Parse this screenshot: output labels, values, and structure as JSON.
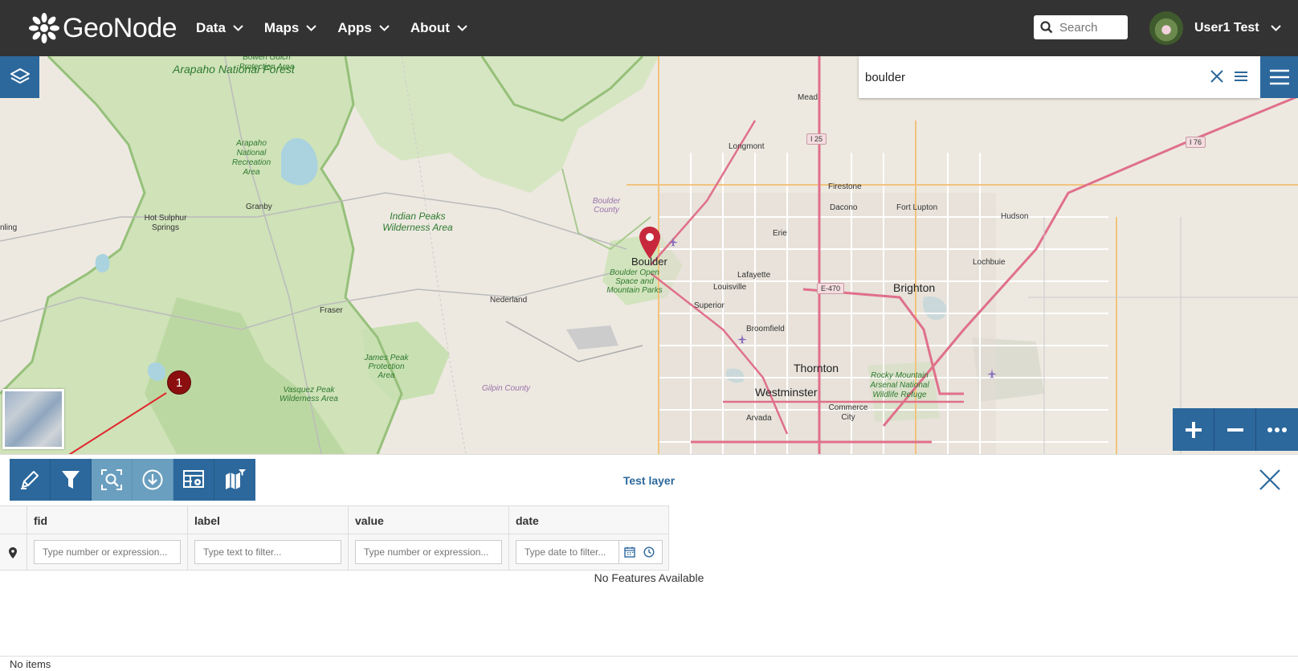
{
  "navbar": {
    "brand": "GeoNode",
    "menus": [
      {
        "label": "Data"
      },
      {
        "label": "Maps"
      },
      {
        "label": "Apps"
      },
      {
        "label": "About"
      }
    ],
    "search_placeholder": "Search",
    "user_name": "User1 Test"
  },
  "map_search": {
    "value": "boulder"
  },
  "map_labels": {
    "arapaho": "Arapaho National Forest",
    "bowen": "Bowen Gulch Protection Area",
    "arapaho_rec": "Arapaho National Recreation Area",
    "hot_sulphur": "Hot Sulphur Springs",
    "granby": "Granby",
    "indian_peaks": "Indian Peaks Wilderness Area",
    "boulder_county": "Boulder County",
    "boulder": "Boulder",
    "boulder_open": "Boulder Open Space and Mountain Parks",
    "nederland": "Nederland",
    "fraser": "Fraser",
    "james_peak": "James Peak Protection Area",
    "vasquez": "Vasquez Peak Wilderness Area",
    "gilpin": "Gilpin County",
    "longmont": "Longmont",
    "mead": "Mead",
    "firestone": "Firestone",
    "dacono": "Dacono",
    "fort_lupton": "Fort Lupton",
    "hudson": "Hudson",
    "erie": "Erie",
    "lafayette": "Lafayette",
    "louisville": "Louisville",
    "superior": "Superior",
    "broomfield": "Broomfield",
    "brighton": "Brighton",
    "lochbuie": "Lochbuie",
    "thornton": "Thornton",
    "westminster": "Westminster",
    "arvada": "Arvada",
    "commerce": "Commerce City",
    "rocky": "Rocky Mountain Arsenal National Wildlife Refuge",
    "nling": "nling",
    "i25": "I 25",
    "i76": "I 76",
    "e470": "E-470"
  },
  "annotation": {
    "marker_number": "1"
  },
  "feature_grid": {
    "title": "Test layer",
    "columns": [
      {
        "name": "fid",
        "placeholder": "Type number or expression..."
      },
      {
        "name": "label",
        "placeholder": "Type text to filter..."
      },
      {
        "name": "value",
        "placeholder": "Type number or expression..."
      },
      {
        "name": "date",
        "placeholder": "Type date to filter..."
      }
    ],
    "empty_message": "No Features Available",
    "footer": "No items"
  },
  "colors": {
    "navbar_bg": "#333333",
    "accent": "#2c689c",
    "accent_light": "#6a9fc0",
    "annotation": "#8b0f0f",
    "map_marker": "#c8283c"
  },
  "icons": {
    "brand": "geonode-flower-icon",
    "layers": "layers-icon",
    "toolbar": [
      "pencil-edit-icon",
      "filter-icon",
      "zoom-to-features-icon",
      "download-icon",
      "grid-settings-icon",
      "sync-map-filter-icon"
    ]
  }
}
